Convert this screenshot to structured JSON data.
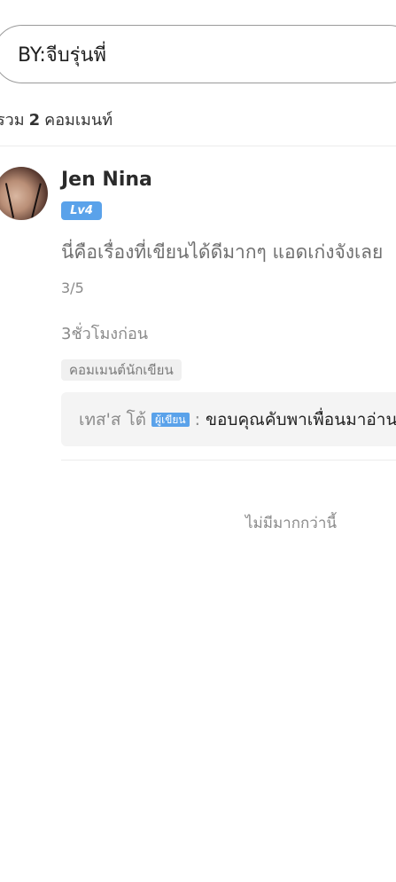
{
  "header": {
    "by_label": "BY:จีบรุ่นพี่"
  },
  "summary": {
    "prefix": "รวม",
    "count": "2",
    "suffix": "คอมเมนท์"
  },
  "comment": {
    "username": "Jen Nina",
    "level": "Lv4",
    "text": "นี่คือเรื่องที่เขียนได้ดีมากๆ แอดเก่งจังเลย",
    "chapter": "3/5",
    "time": "3ชั่วโมงก่อน",
    "tag": "คอมเมนต์นักเขียน",
    "reply": {
      "name": "เทส'ส โต้",
      "badge": "ผู้เขียน",
      "colon": ":",
      "text": "ขอบคุณคับพาเพื่อนมาอ่านด้วยนะ"
    }
  },
  "footer": {
    "no_more": "ไม่มีมากกว่านี้"
  },
  "colors": {
    "badge_blue": "#5aa2ea",
    "muted_text": "#8a8a8a",
    "reply_bg": "#f4f4f4"
  }
}
